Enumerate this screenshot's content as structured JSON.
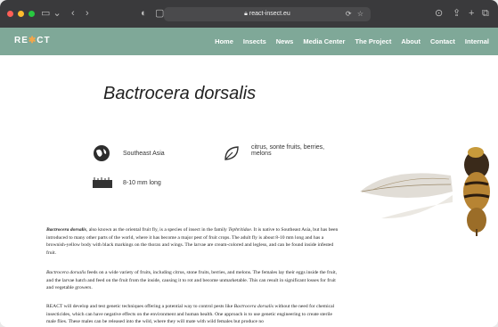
{
  "browser": {
    "url": "react-insect.eu",
    "traffic_lights": [
      "#ff5f57",
      "#febc2e",
      "#28c840"
    ]
  },
  "site": {
    "logo_text_1": "RE",
    "logo_text_2": "CT",
    "nav": [
      "Home",
      "Insects",
      "News",
      "Media Center",
      "The Project",
      "About",
      "Contact",
      "Internal"
    ],
    "nav_color": "#7fa898"
  },
  "page": {
    "title": "Bactrocera dorsalis",
    "facts": {
      "region": "Southeast Asia",
      "hosts_line1": "citrus, sonte fruits, berries,",
      "hosts_line2": "melons",
      "size": "8-10 mm long"
    },
    "para1": {
      "name": "Bactrocera dorsalis",
      "text": ", also known as the oriental fruit fly, is a species of insect in the family ",
      "family": "Tephritidae",
      "text2": ". It is native to Southeast Asia, but has been introduced to many other parts of the world, where it has become a major pest of fruit crops. The adult fly is about 8-10 mm long and has a brownish-yellow body with black markings on the thorax and wings. The larvae are cream-colored and legless, and can be found inside infested fruit."
    },
    "para2": {
      "name": "Bactrocera dorsalis",
      "text": " feeds on a wide variety of fruits, including citrus, stone fruits, berries, and melons. The females lay their eggs inside the fruit, and the larvae hatch and feed on the fruit from the inside, causing it to rot and become unmarketable. This can result in significant losses for fruit and vegetable growers."
    },
    "para3": {
      "text": "REACT will develop and test genetic techniques offering a potential way to control pests like ",
      "name": "Bactrocera dorsalis",
      "text2": " without the need for chemical insecticides, which can have negative effects on the environment and human health. One approach is to use genetic engineering to create sterile male flies. These males can be released into the wild, where they will mate with wild females but produce no"
    }
  }
}
